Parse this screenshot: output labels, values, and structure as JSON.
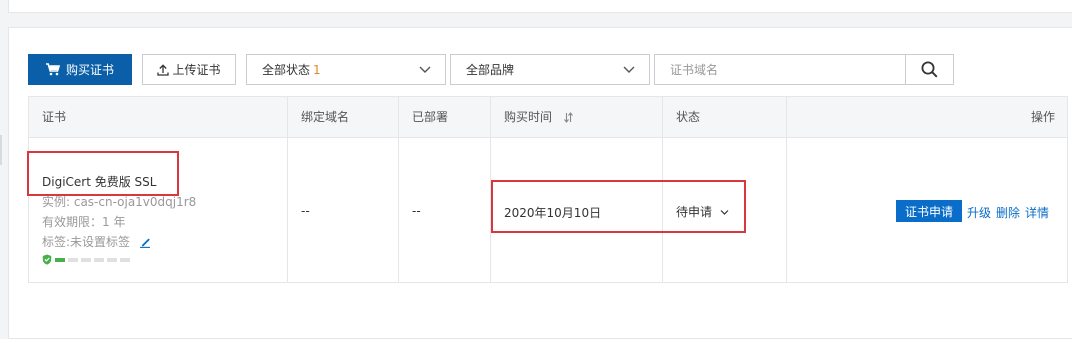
{
  "toolbar": {
    "buy_label": "购买证书",
    "upload_label": "上传证书",
    "status_select": {
      "label": "全部状态",
      "count": "1"
    },
    "brand_select": {
      "label": "全部品牌"
    },
    "search": {
      "placeholder": "证书域名",
      "value": ""
    }
  },
  "table": {
    "headers": {
      "cert": "证书",
      "domain": "绑定域名",
      "deployed": "已部署",
      "purchase_time": "购买时间",
      "status": "状态",
      "actions": "操作"
    },
    "row": {
      "cert_name": "DigiCert 免费版 SSL",
      "instance": "实例: cas-cn-oja1v0dqj1r8",
      "validity": "有效期限：1 年",
      "tag": "标签:未设置标签",
      "domain": "--",
      "deployed": "--",
      "purchase_time": "2020年10月10日",
      "status": "待申请",
      "actions": {
        "apply": "证书申请",
        "upgrade": "升级",
        "delete": "删除",
        "detail": "详情"
      }
    }
  },
  "colors": {
    "primary": "#0a5fa8",
    "link": "#0a6dc9",
    "highlight": "#d9363e",
    "count": "#e0872f",
    "shield": "#46b04a"
  }
}
